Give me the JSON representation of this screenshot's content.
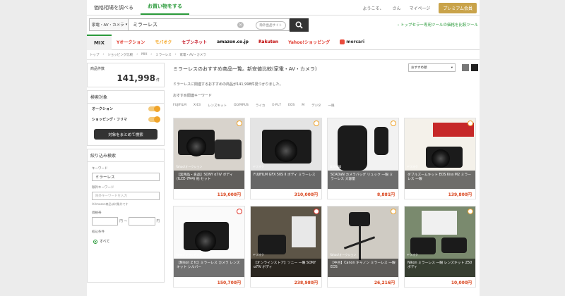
{
  "top_tabs": [
    {
      "label": "価格相場を調べる"
    },
    {
      "label": "お買い物をする"
    }
  ],
  "top_right": {
    "welcome": "ようこそ、",
    "user": "さん",
    "mypage": "マイページ",
    "premium": "プレミアム会員"
  },
  "search": {
    "category": "家電・AV・カメラ",
    "query": "ミラーレス",
    "exclude": "除外出品サイト"
  },
  "side_link": "トップセラー専用ツールの価格を比較ツール",
  "shops": [
    {
      "label": "MIX",
      "color": "#333333"
    },
    {
      "label": "Yオークション",
      "color": "#e0362a"
    },
    {
      "label": "モバオク",
      "color": "#f5a623"
    },
    {
      "label": "セブンネット",
      "color": "#c71c2a"
    },
    {
      "label": "amazon.co.jp",
      "color": "#111111"
    },
    {
      "label": "Rakuten",
      "color": "#bf0000"
    },
    {
      "label": "Yahoo!ショッピング",
      "color": "#e0362a"
    },
    {
      "label": "mercari",
      "color": "#333333"
    }
  ],
  "breadcrumbs": [
    "トップ",
    "ショッピング比較",
    "MIX",
    "ミラーレス",
    "家電・AV・カメラ"
  ],
  "sidebar": {
    "count_label": "商品件数",
    "count": "141,998",
    "count_unit": "件",
    "target_label": "検索対象",
    "toggle1": "オークション",
    "toggle2": "ショッピング・フリマ",
    "search_all": "対象をまとめて検索",
    "filter_label": "絞り込み検索",
    "keyword_label": "キーワード",
    "keyword_value": "ミラーレス",
    "exclude_label": "除外キーワード",
    "exclude_placeholder": "除外キーワードを入力",
    "exclude_note": "※Amazon商品は対象外です",
    "price_label": "価格帯",
    "price_yen": "円",
    "price_sep": "〜",
    "status_label": "絞込条件",
    "status_all": "すべて"
  },
  "content": {
    "title": "ミラーレスのおすすめ商品一覧。新安値比較(家電・AV・カメラ)",
    "count_text": "ミラーレスに関連するおすすめの商品が141,998件見つかりました。",
    "kw_title": "おすすめ関連キーワード",
    "keywords": [
      "FUJIFILM",
      "X-E3",
      "レンズキット",
      "OLYMPUS",
      "ライカ",
      "E-PL7",
      "EOS",
      "M",
      "デジタ",
      "一眼"
    ],
    "sort": "おすすめ順"
  },
  "products": [
    {
      "shop": "Yahoo!オークション",
      "title": "【実用品・良品】SONY α7iV ボディ (ILCE-7M4) 他 セット",
      "price": "119,000円"
    },
    {
      "shop": "ヤフオク",
      "title": "FUJIFILM GFX 50S II ボディ ミラーレス",
      "price": "310,000円"
    },
    {
      "shop": "楽天市場",
      "title": "SCADaN カメラバッグ リュック 一眼 ミラーレス 大容量",
      "price": "8,881円"
    },
    {
      "shop": "ヤフオク",
      "title": "ダブルズームキット EOS Kiss M2 ミラーレス 一眼",
      "price": "139,800円"
    },
    {
      "shop": "Yahoo!ショッピング",
      "title": "【Nikon Z fc】ミラーレス カメラ レンズキット シルバー",
      "price": "150,700円"
    },
    {
      "shop": "ヤフオク",
      "title": "【オンラインストア】ソニー 一眼 SONY α7IV ボディ",
      "price": "238,980円"
    },
    {
      "shop": "Yahoo!オークション",
      "title": "【中古】Canon キャノン ミラーレス 一眼 EOS",
      "price": "26,216円"
    },
    {
      "shop": "ヤフオク",
      "title": "Nikon ミラーレス 一眼 レンズキット Z50 ボディ",
      "price": "10,000円"
    }
  ]
}
